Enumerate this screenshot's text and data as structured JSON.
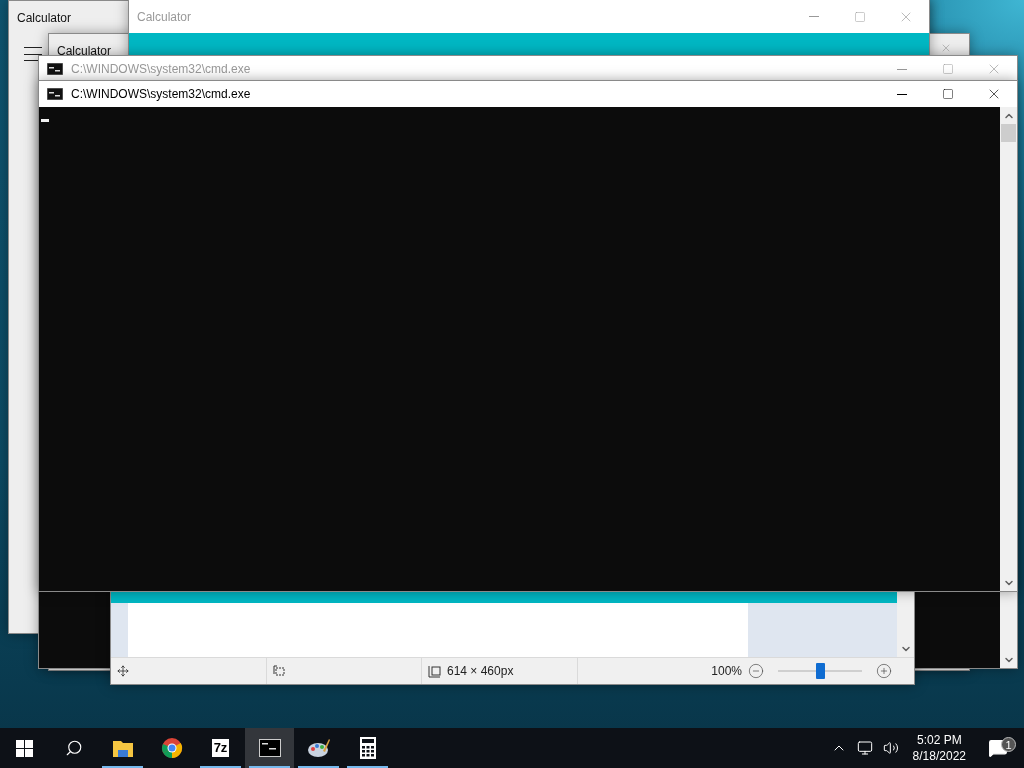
{
  "windows": [
    {
      "kind": "calculator_nav",
      "title": "Calculator"
    },
    {
      "kind": "calculator_nav",
      "title": "Calculator"
    },
    {
      "kind": "paint",
      "size": "614 × 460px",
      "zoom": "100%",
      "level": 0.5
    },
    {
      "kind": "calculator",
      "title": "Calculator",
      "active": false
    },
    {
      "kind": "cmd",
      "title": "C:\\WINDOWS\\system32\\cmd.exe",
      "active": false
    },
    {
      "kind": "cmd",
      "title": "C:\\WINDOWS\\system32\\cmd.exe",
      "active": true
    }
  ],
  "taskbar": {
    "apps": [
      {
        "kind": "start",
        "running": false,
        "selected": false
      },
      {
        "kind": "search",
        "running": false,
        "selected": false
      },
      {
        "kind": "explorer",
        "running": true,
        "selected": false
      },
      {
        "kind": "chrome",
        "running": false,
        "selected": false
      },
      {
        "kind": "sevenzip",
        "label": "7z",
        "running": true,
        "selected": false
      },
      {
        "kind": "cmd",
        "running": true,
        "selected": true
      },
      {
        "kind": "paint",
        "running": true,
        "selected": false
      },
      {
        "kind": "calculator",
        "running": true,
        "selected": false
      }
    ],
    "tray": {
      "time": "5:02 PM",
      "date": "8/18/2022",
      "notifications": "1"
    }
  }
}
